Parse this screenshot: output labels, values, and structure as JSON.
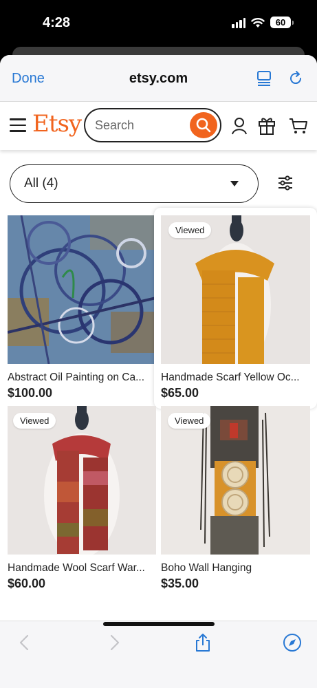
{
  "status": {
    "time": "4:28",
    "battery": "60"
  },
  "browser": {
    "done_label": "Done",
    "domain": "etsy.com"
  },
  "etsy": {
    "logo": "Etsy",
    "search_placeholder": "Search"
  },
  "filter": {
    "selected": "All (4)"
  },
  "listings": [
    {
      "title": "Abstract Oil Painting on Ca...",
      "price": "$100.00",
      "viewed": ""
    },
    {
      "title": "Handmade Scarf Yellow Oc...",
      "price": "$65.00",
      "viewed": "Viewed"
    },
    {
      "title": "Handmade Wool Scarf War...",
      "price": "$60.00",
      "viewed": "Viewed"
    },
    {
      "title": "Boho Wall Hanging",
      "price": "$35.00",
      "viewed": "Viewed"
    }
  ],
  "colors": {
    "accent": "#f1641e",
    "ios_blue": "#2878d4"
  },
  "icons": [
    "menu-icon",
    "search-icon",
    "user-icon",
    "gift-icon",
    "cart-icon",
    "filter-icon",
    "back-icon",
    "forward-icon",
    "share-icon",
    "compass-icon",
    "reader-icon",
    "reload-icon"
  ]
}
